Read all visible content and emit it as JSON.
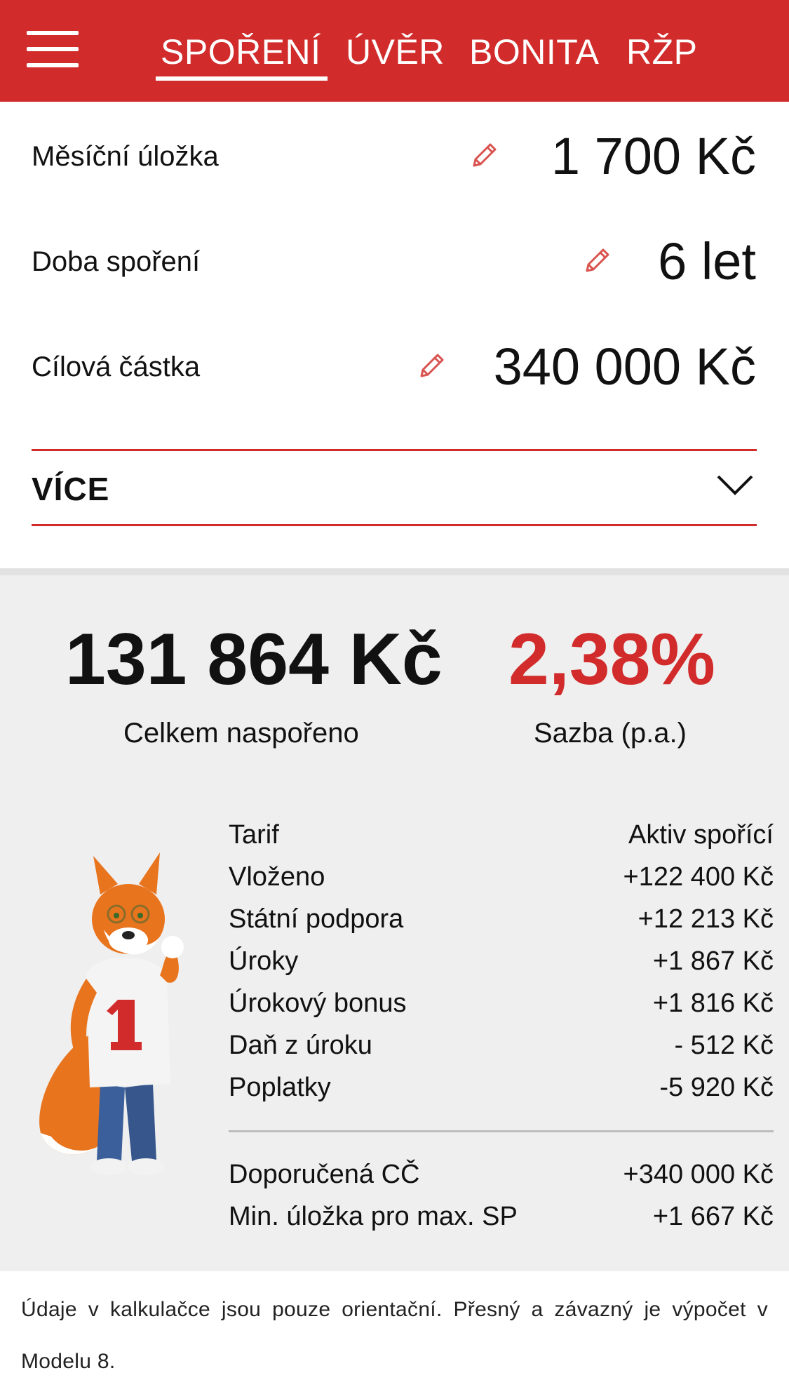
{
  "header": {
    "tabs": [
      {
        "label": "SPOŘENÍ",
        "active": true
      },
      {
        "label": "ÚVĚR",
        "active": false
      },
      {
        "label": "BONITA",
        "active": false
      },
      {
        "label": "RŽP",
        "active": false
      }
    ],
    "accent_color": "#d22b2b",
    "menu_icon": "hamburger-menu-icon"
  },
  "inputs": [
    {
      "label": "Měsíční úložka",
      "value": "1 700 Kč",
      "icon": "pencil-edit-icon"
    },
    {
      "label": "Doba spoření",
      "value": "6 let",
      "icon": "pencil-edit-icon"
    },
    {
      "label": "Cílová částka",
      "value": "340 000 Kč",
      "icon": "pencil-edit-icon"
    }
  ],
  "more": {
    "label": "VÍCE",
    "icon": "chevron-down-icon"
  },
  "results": {
    "total_value": "131 864 Kč",
    "total_caption": "Celkem naspořeno",
    "rate_value": "2,38%",
    "rate_caption": "Sazba (p.a.)",
    "rate_color": "#d22b2b"
  },
  "details": [
    {
      "label": "Tarif",
      "value": "Aktiv spořící"
    },
    {
      "label": "Vloženo",
      "value": "+122 400 Kč"
    },
    {
      "label": "Státní podpora",
      "value": "+12 213 Kč"
    },
    {
      "label": "Úroky",
      "value": "+1 867 Kč"
    },
    {
      "label": "Úrokový bonus",
      "value": "+1 816 Kč"
    },
    {
      "label": "Daň z úroku",
      "value": "- 512 Kč"
    },
    {
      "label": "Poplatky",
      "value": "-5 920 Kč"
    }
  ],
  "details_summary": [
    {
      "label": "Doporučená CČ",
      "value": "+340 000 Kč"
    },
    {
      "label": "Min. úložka pro max. SP",
      "value": "+1 667 Kč"
    }
  ],
  "mascot": "fox-mascot-image",
  "footer": {
    "note": "Údaje v kalkulačce jsou pouze orientační. Přesný a závazný je výpočet v Modelu 8."
  }
}
